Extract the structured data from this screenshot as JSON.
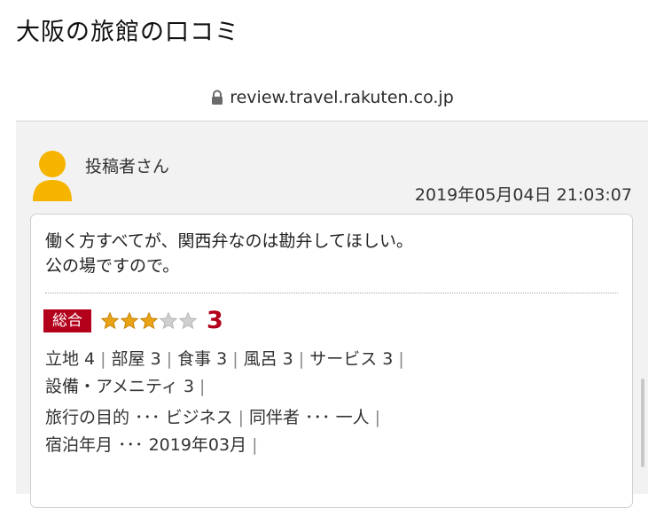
{
  "post": {
    "title": "大阪の旅館の口コミ"
  },
  "browser": {
    "url": "review.travel.rakuten.co.jp"
  },
  "review": {
    "reviewer": "投稿者さん",
    "timestamp": "2019年05月04日 21:03:07",
    "comment_line1": "働く方すべてが、関西弁なのは勘弁してほしい。",
    "comment_line2": "公の場ですので。",
    "overall": {
      "label": "総合",
      "score": "3",
      "stars_filled": 3,
      "stars_total": 5
    },
    "ratings": [
      {
        "text": "立地 4"
      },
      {
        "text": "部屋 3"
      },
      {
        "text": "食事 3"
      },
      {
        "text": "風呂 3"
      },
      {
        "text": "サービス 3"
      },
      {
        "text": "設備・アメニティ 3"
      }
    ],
    "trip": {
      "purpose": "旅行の目的 ･･･ ビジネス",
      "companion": "同伴者 ･･･ 一人",
      "stay": "宿泊年月 ･･･ 2019年03月"
    }
  },
  "colors": {
    "accent": "#b3001b",
    "star": "#e8a317",
    "star_empty": "#cfcfcf",
    "avatar": "#f5b400"
  },
  "icons": {
    "lock": "lock-icon",
    "avatar": "user-avatar-icon",
    "star": "star-icon"
  }
}
